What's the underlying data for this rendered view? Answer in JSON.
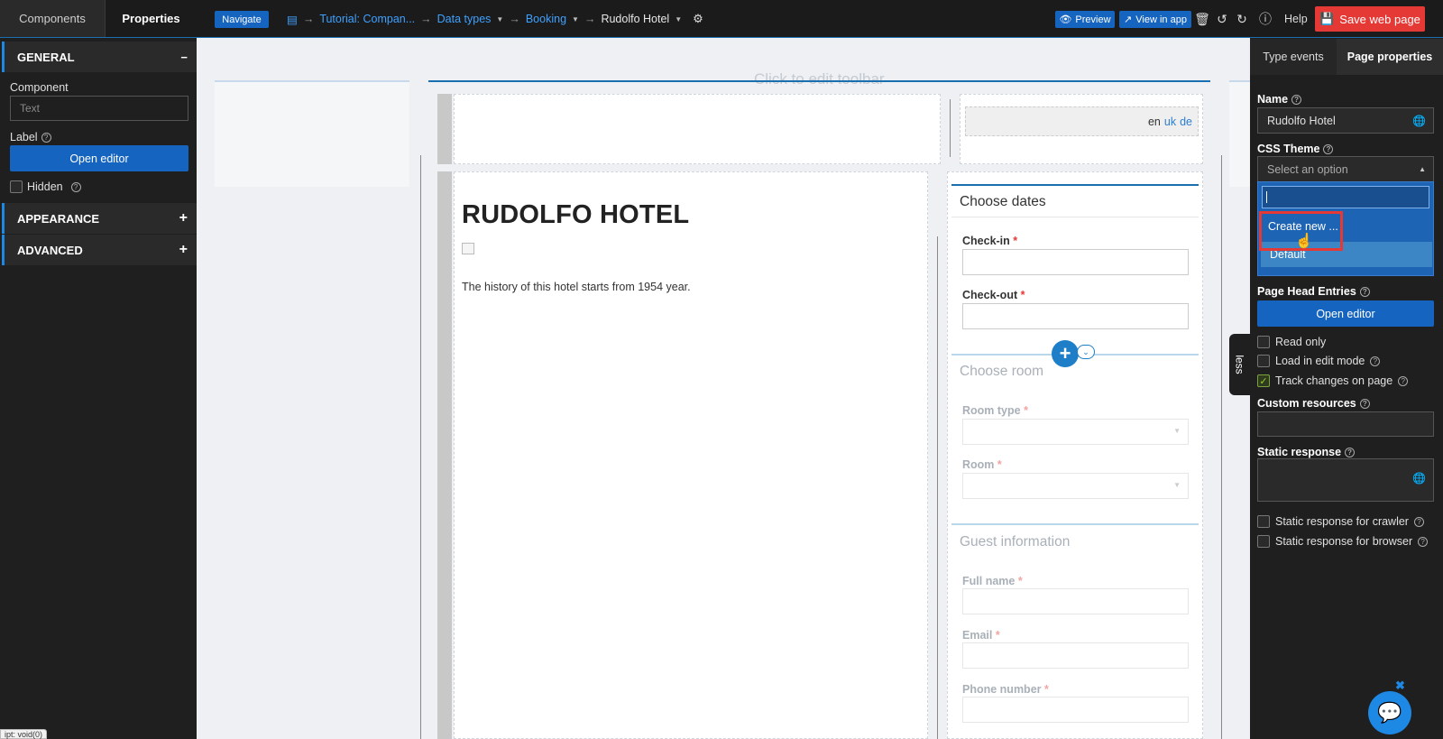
{
  "topbar": {
    "tab_components": "Components",
    "tab_properties": "Properties",
    "navigate": "Navigate",
    "breadcrumbs": [
      "Tutorial: Compan...",
      "Data types",
      "Booking",
      "Rudolfo Hotel"
    ],
    "preview": "Preview",
    "view_in_app": "View in app",
    "help": "Help",
    "save": "Save web page"
  },
  "left": {
    "general": "GENERAL",
    "general_toggle": "−",
    "component_label": "Component",
    "component_placeholder": "Text",
    "label_label": "Label",
    "open_editor": "Open editor",
    "hidden_label": "Hidden",
    "appearance": "APPEARANCE",
    "advanced": "ADVANCED",
    "plus": "+"
  },
  "canvas": {
    "toolbar_hint": "Click to edit toolbar",
    "lang_en": "en",
    "lang_uk": "uk",
    "lang_de": "de",
    "title": "RUDOLFO HOTEL",
    "history": "The history of this hotel starts from 1954 year.",
    "choose_dates": "Choose dates",
    "check_in": "Check-in",
    "check_out": "Check-out",
    "choose_room": "Choose room",
    "room_type": "Room type",
    "room": "Room",
    "guest_info": "Guest information",
    "full_name": "Full name",
    "email": "Email",
    "phone": "Phone number",
    "req": "*",
    "less": "less"
  },
  "right": {
    "tab_type_events": "Type events",
    "tab_page_properties": "Page properties",
    "name_label": "Name",
    "name_value": "Rudolfo Hotel",
    "css_theme_label": "CSS Theme",
    "css_theme_placeholder": "Select an option",
    "dropdown_create": "Create new ...",
    "dropdown_default": "Default",
    "head_entries_label": "Page Head Entries",
    "open_editor": "Open editor",
    "read_only": "Read only",
    "load_edit_mode": "Load in edit mode",
    "track_changes": "Track changes on page",
    "custom_resources": "Custom resources",
    "static_response": "Static response",
    "static_crawler": "Static response for crawler",
    "static_browser": "Static response for browser"
  },
  "status_bar": "ipt: void(0)",
  "colors": {
    "accent": "#1565c0",
    "save": "#e53935",
    "highlight": "#e53935"
  }
}
